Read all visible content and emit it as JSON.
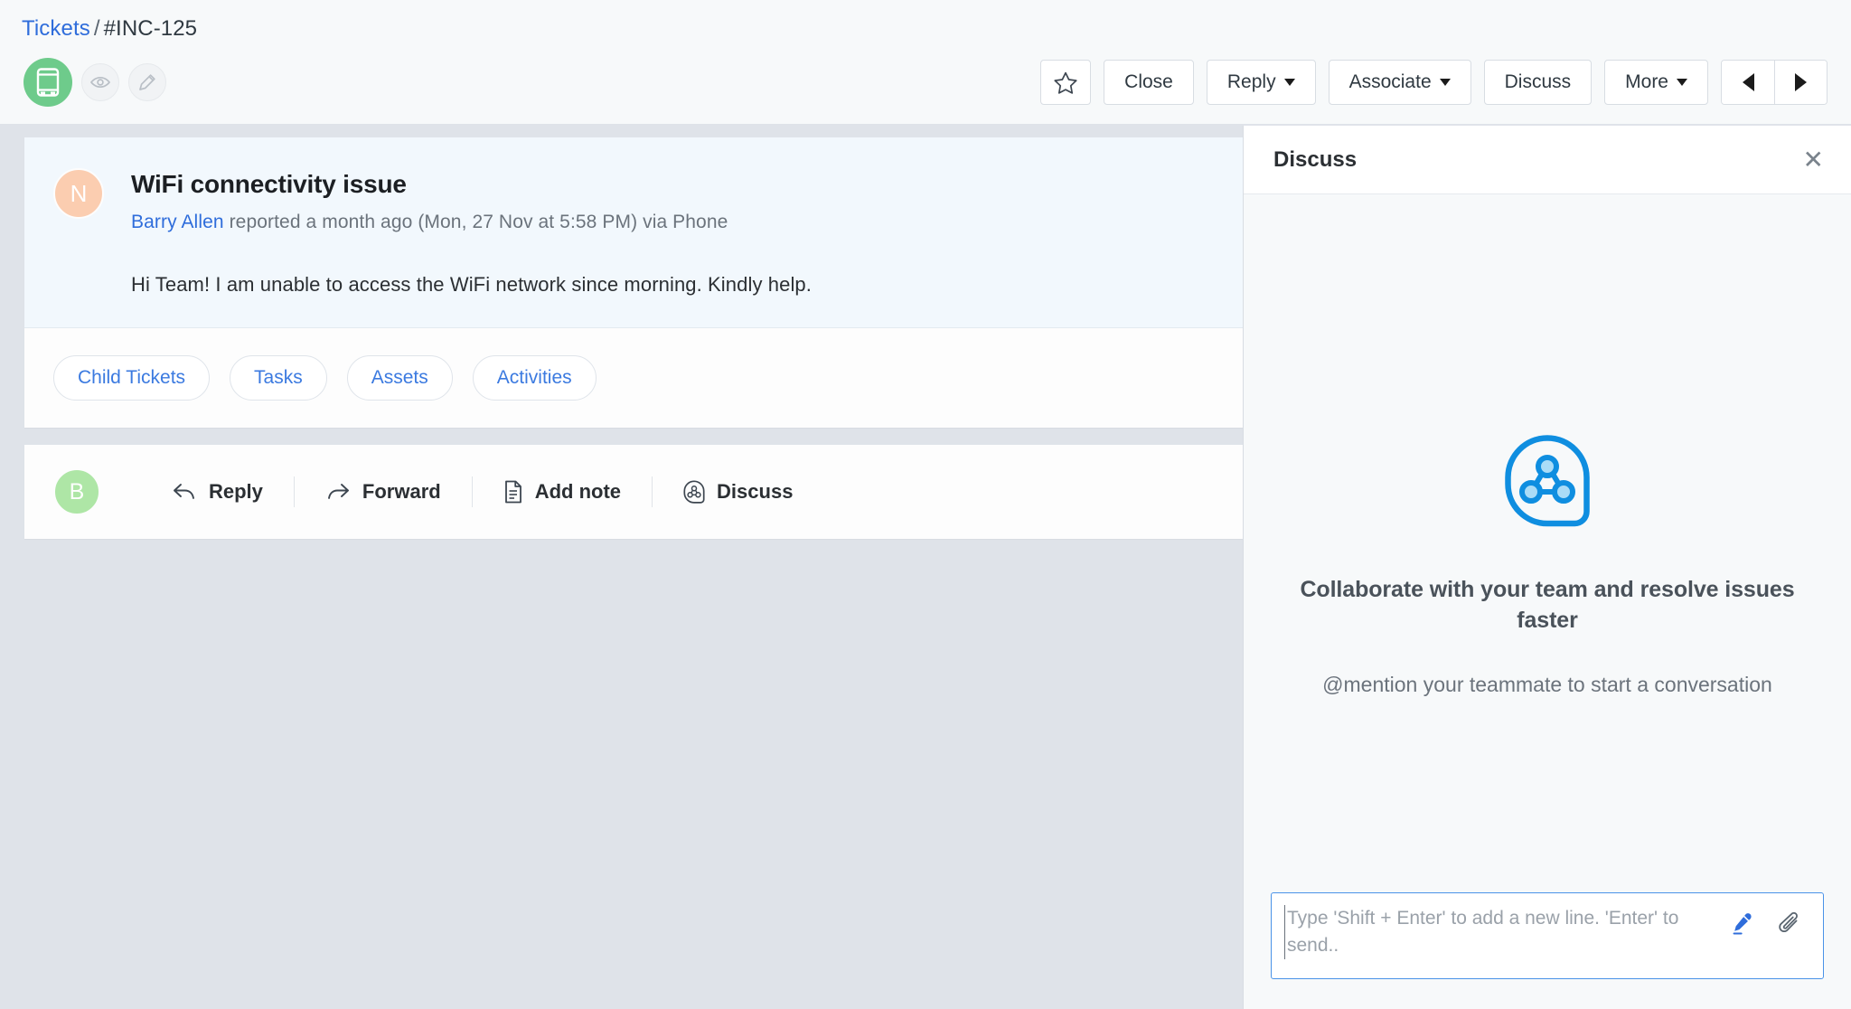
{
  "breadcrumb": {
    "parent": "Tickets",
    "separator": "/",
    "current": "#INC-125"
  },
  "channel": {
    "badge_icon": "mobile-phone-icon",
    "badge_color": "#6ecb8b",
    "watch_icon": "eye-icon",
    "edit_icon": "pencil-icon"
  },
  "toolbar": {
    "star_icon": "star-outline-icon",
    "close_label": "Close",
    "reply_label": "Reply",
    "associate_label": "Associate",
    "discuss_label": "Discuss",
    "more_label": "More",
    "prev_icon": "triangle-left-icon",
    "next_icon": "triangle-right-icon"
  },
  "ticket": {
    "avatar_initial": "N",
    "avatar_color": "#fbcdb0",
    "title": "WiFi connectivity issue",
    "reporter": "Barry Allen",
    "meta_suffix": " reported a month ago (Mon, 27 Nov at 5:58 PM) via Phone",
    "body": "Hi Team! I am unable to access the WiFi network since morning. Kindly help."
  },
  "pills": [
    {
      "label": "Child Tickets"
    },
    {
      "label": "Tasks"
    },
    {
      "label": "Assets"
    },
    {
      "label": "Activities"
    }
  ],
  "action_bar": {
    "avatar_initial": "B",
    "avatar_color": "#aee6a6",
    "actions": [
      {
        "label": "Reply",
        "icon": "reply-arrow-icon"
      },
      {
        "label": "Forward",
        "icon": "forward-arrow-icon"
      },
      {
        "label": "Add note",
        "icon": "note-document-icon"
      },
      {
        "label": "Discuss",
        "icon": "collaborate-icon"
      }
    ]
  },
  "discuss_panel": {
    "title": "Discuss",
    "close_icon": "close-x-icon",
    "illustration_icon": "collaborate-bubble-icon",
    "accent_color": "#0f8ee0",
    "empty_title": "Collaborate with your team and resolve issues faster",
    "empty_subtitle": "@mention your teammate to start a conversation",
    "composer": {
      "placeholder": "Type 'Shift + Enter' to add a new line. 'Enter' to send..",
      "value": "",
      "pen_icon": "pen-icon",
      "attach_icon": "paperclip-icon"
    }
  }
}
